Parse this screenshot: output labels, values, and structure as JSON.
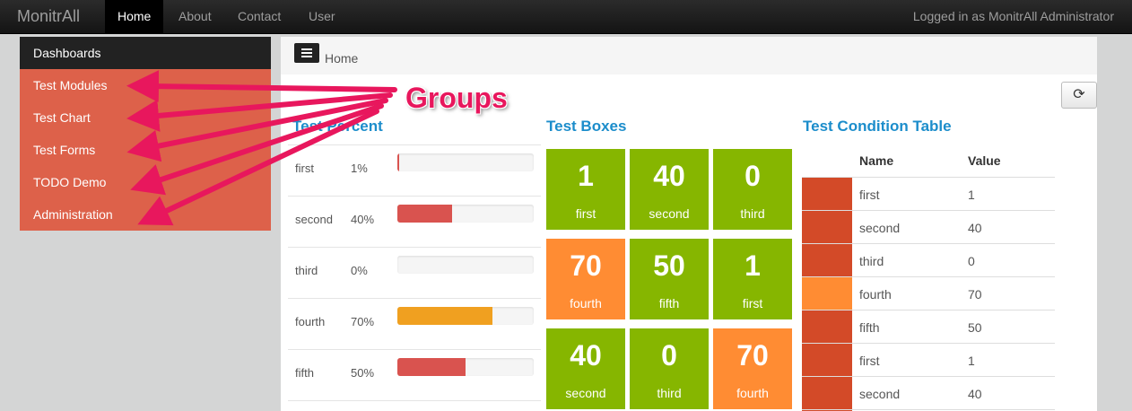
{
  "navbar": {
    "brand": "MonitrAll",
    "items": [
      {
        "label": "Home",
        "active": true
      },
      {
        "label": "About"
      },
      {
        "label": "Contact"
      },
      {
        "label": "User"
      }
    ],
    "login_text": "Logged in as MonitrAll Administrator"
  },
  "sidebar": {
    "header": "Dashboards",
    "items": [
      {
        "label": "Test Modules"
      },
      {
        "label": "Test Chart"
      },
      {
        "label": "Test Forms"
      },
      {
        "label": "TODO Demo"
      },
      {
        "label": "Administration"
      }
    ]
  },
  "breadcrumb": {
    "label": "Home"
  },
  "refresh_icon": "⟳",
  "annotation": {
    "label": "Groups",
    "color": "#e8175d"
  },
  "percent": {
    "title": "Test Percent",
    "rows": [
      {
        "name": "first",
        "pct": "1%",
        "value": 1,
        "color": "#d9534f"
      },
      {
        "name": "second",
        "pct": "40%",
        "value": 40,
        "color": "#d9534f"
      },
      {
        "name": "third",
        "pct": "0%",
        "value": 0,
        "color": "#d9534f"
      },
      {
        "name": "fourth",
        "pct": "70%",
        "value": 70,
        "color": "#f0a020"
      },
      {
        "name": "fifth",
        "pct": "50%",
        "value": 50,
        "color": "#d9534f"
      }
    ]
  },
  "boxes": {
    "title": "Test Boxes",
    "items": [
      {
        "value": "1",
        "label": "first",
        "color": "#86b600"
      },
      {
        "value": "40",
        "label": "second",
        "color": "#86b600"
      },
      {
        "value": "0",
        "label": "third",
        "color": "#86b600"
      },
      {
        "value": "70",
        "label": "fourth",
        "color": "#ff8c33"
      },
      {
        "value": "50",
        "label": "fifth",
        "color": "#86b600"
      },
      {
        "value": "1",
        "label": "first",
        "color": "#86b600"
      },
      {
        "value": "40",
        "label": "second",
        "color": "#86b600"
      },
      {
        "value": "0",
        "label": "third",
        "color": "#86b600"
      },
      {
        "value": "70",
        "label": "fourth",
        "color": "#ff8c33"
      }
    ]
  },
  "condition_table": {
    "title": "Test Condition Table",
    "headers": {
      "name": "Name",
      "value": "Value"
    },
    "rows": [
      {
        "name": "first",
        "value": "1",
        "color": "#d34a28"
      },
      {
        "name": "second",
        "value": "40",
        "color": "#d34a28"
      },
      {
        "name": "third",
        "value": "0",
        "color": "#d34a28"
      },
      {
        "name": "fourth",
        "value": "70",
        "color": "#ff8c33"
      },
      {
        "name": "fifth",
        "value": "50",
        "color": "#d34a28"
      },
      {
        "name": "first",
        "value": "1",
        "color": "#d34a28"
      },
      {
        "name": "second",
        "value": "40",
        "color": "#d34a28"
      }
    ]
  }
}
